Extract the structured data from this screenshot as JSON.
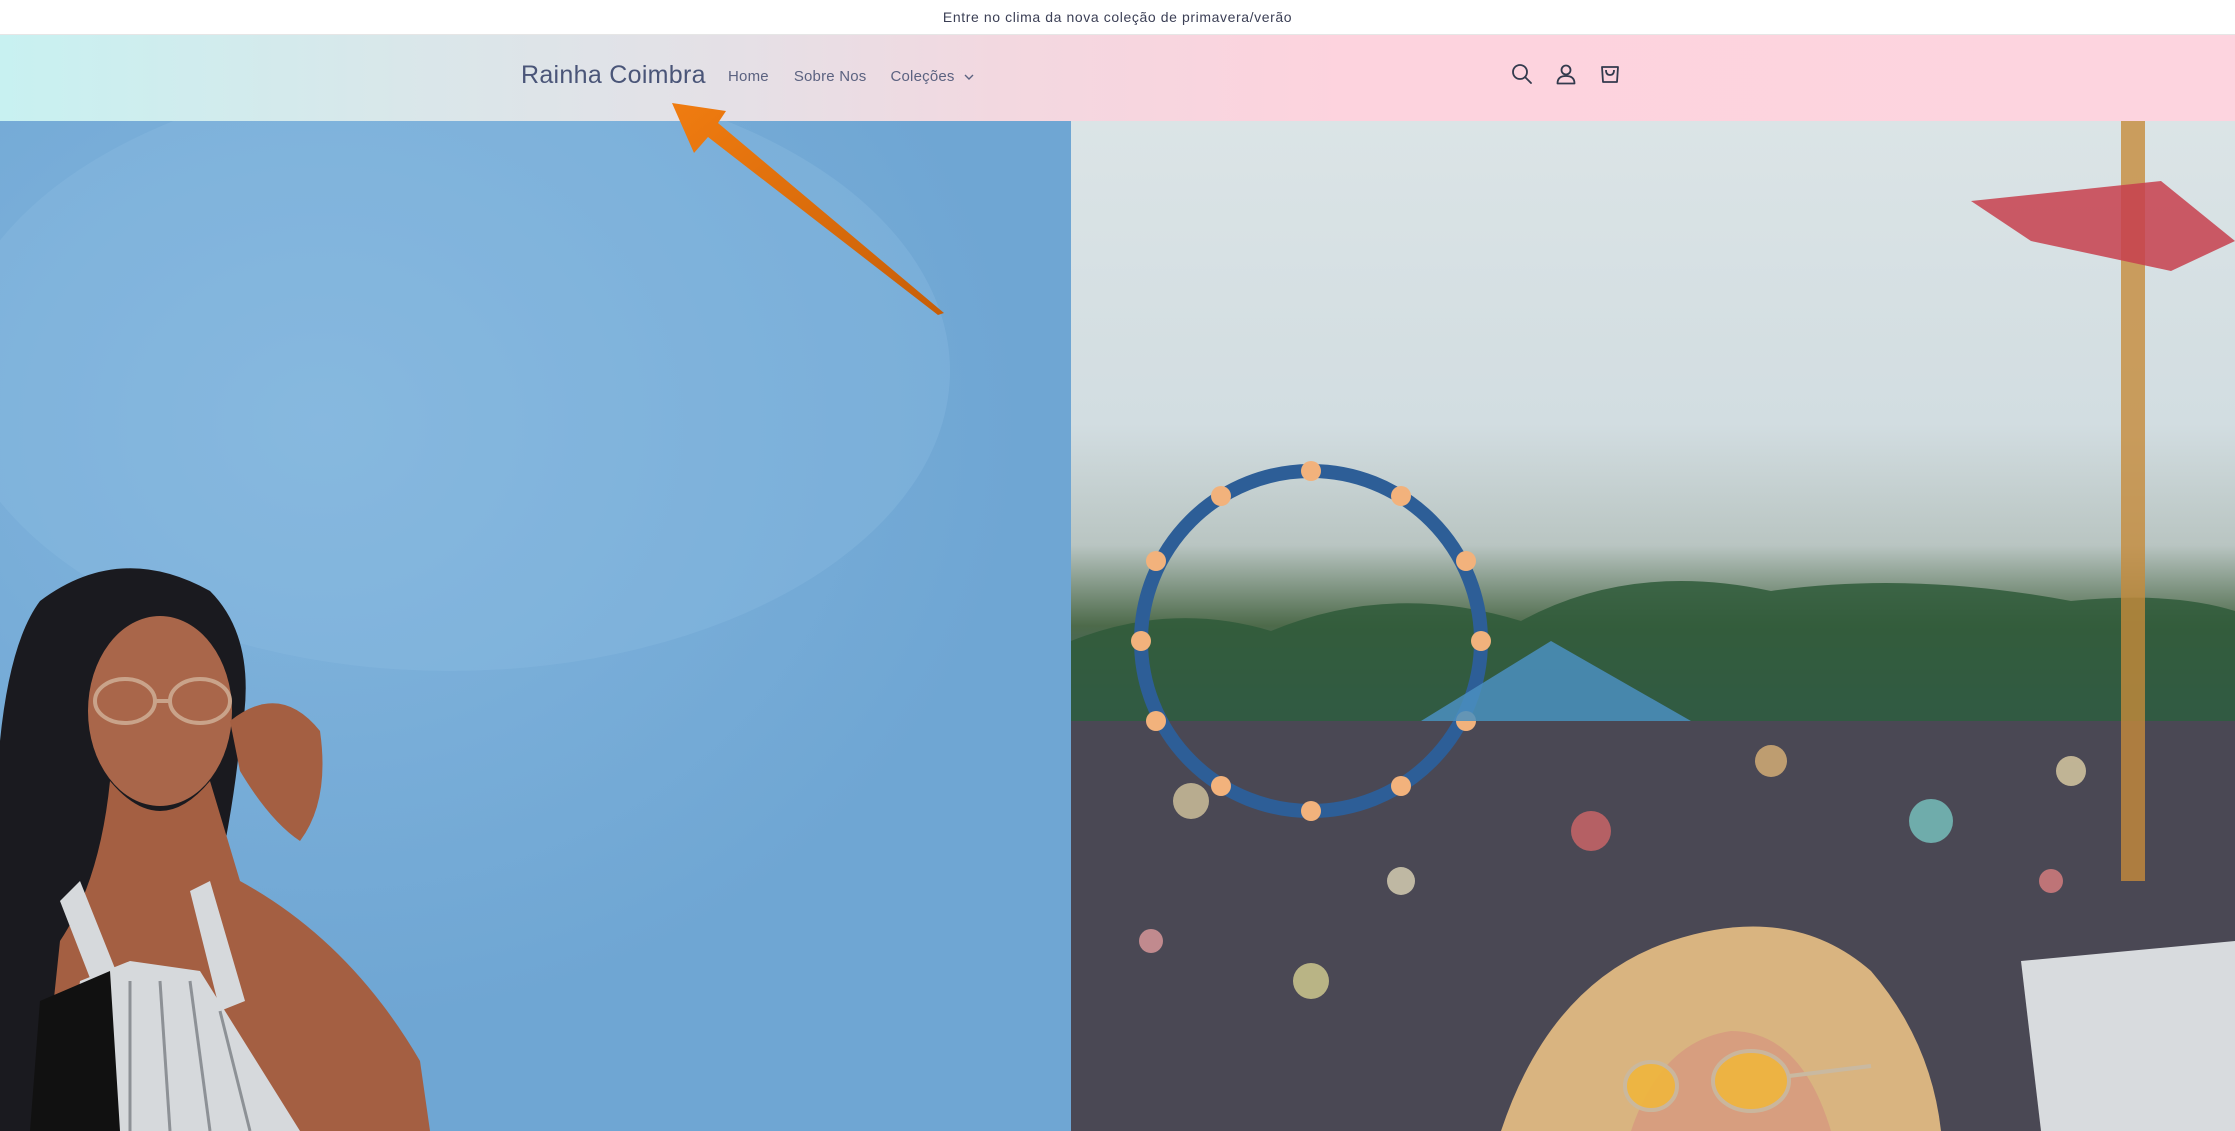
{
  "announcement": {
    "text": "Entre no clima da nova coleção de primavera/verão"
  },
  "header": {
    "logo": "Rainha Coimbra",
    "nav": [
      {
        "label": "Home"
      },
      {
        "label": "Sobre Nos"
      },
      {
        "label": "Coleções"
      }
    ],
    "icons": [
      "search-icon",
      "account-icon",
      "cart-icon"
    ]
  },
  "colors": {
    "header_left": "#c8f1f1",
    "header_right": "#fdd4df",
    "accent_arrow": "#e8730f",
    "hero_left": "#78add8"
  }
}
